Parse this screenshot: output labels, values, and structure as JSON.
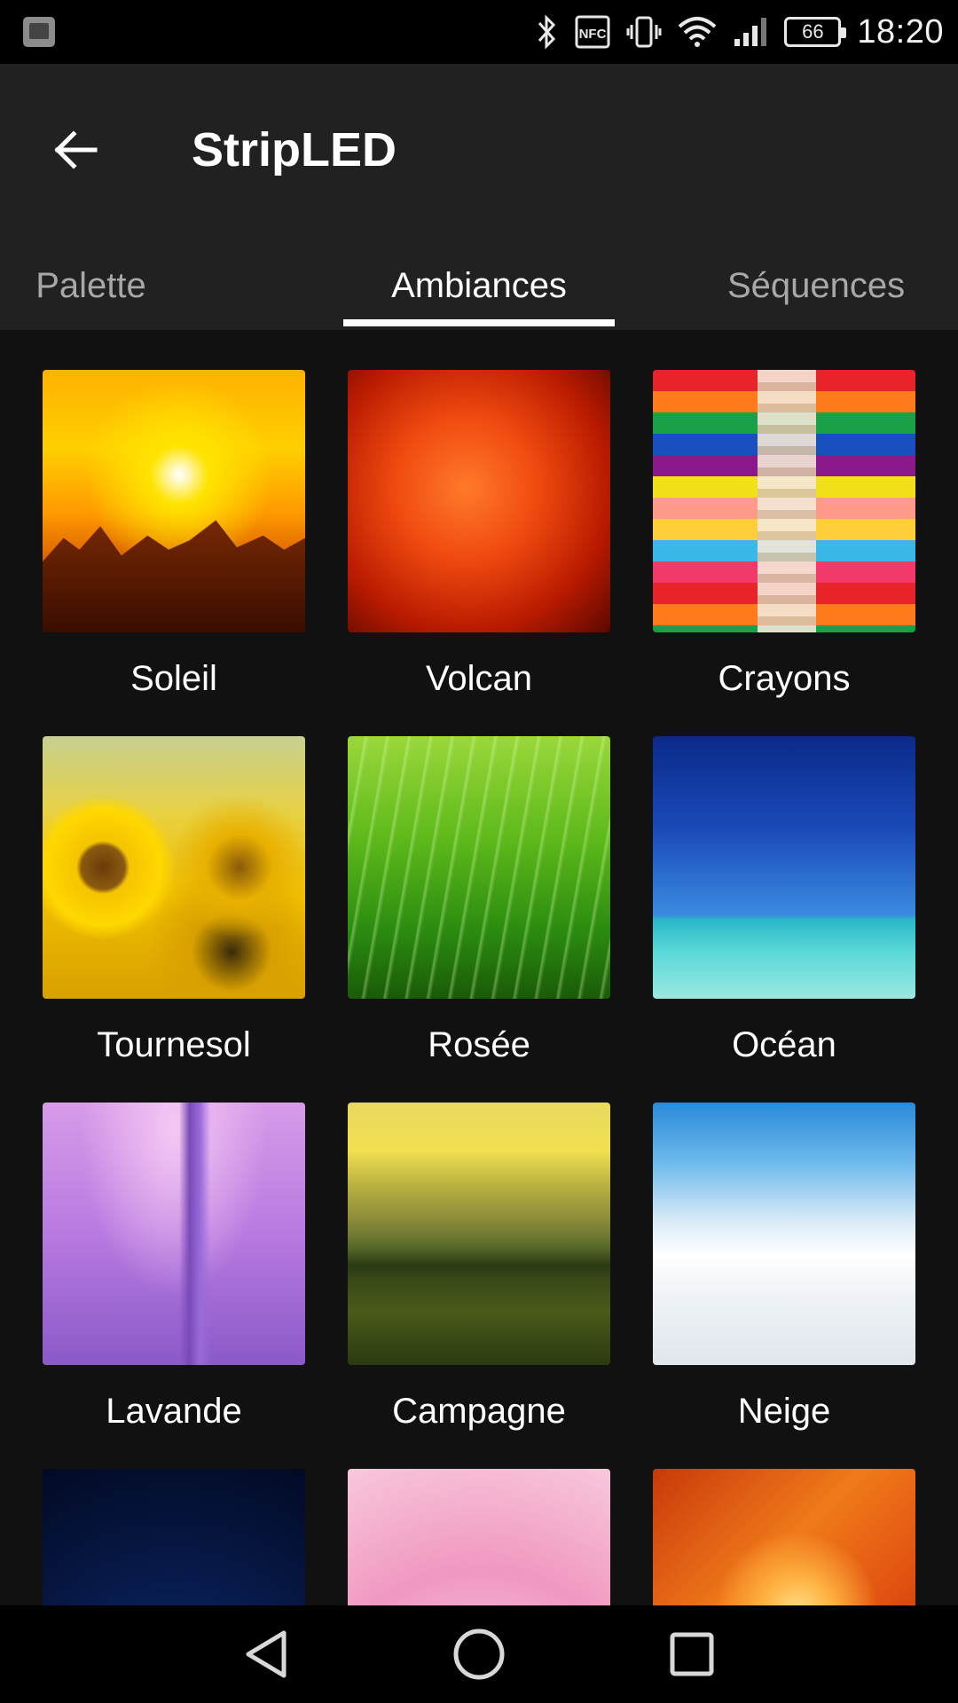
{
  "status_bar": {
    "time": "18:20",
    "battery": "66",
    "icons": [
      "gallery-notification-icon",
      "bluetooth-icon",
      "nfc-icon",
      "vibrate-icon",
      "wifi-icon",
      "signal-icon",
      "battery-icon"
    ],
    "nfc_label": "NFC"
  },
  "app_bar": {
    "title": "StripLED",
    "back_icon": "arrow-left-icon"
  },
  "tabs": [
    {
      "label": "Palette",
      "selected": false
    },
    {
      "label": "Ambiances",
      "selected": true
    },
    {
      "label": "Séquences",
      "selected": false
    }
  ],
  "ambiances": [
    {
      "label": "Soleil",
      "image": "sunset-over-mountains"
    },
    {
      "label": "Volcan",
      "image": "red-lava-rock"
    },
    {
      "label": "Crayons",
      "image": "colored-pencils"
    },
    {
      "label": "Tournesol",
      "image": "sunflowers"
    },
    {
      "label": "Rosée",
      "image": "dewy-green-grass"
    },
    {
      "label": "Océan",
      "image": "blue-sea-horizon"
    },
    {
      "label": "Lavande",
      "image": "lavender-flowers"
    },
    {
      "label": "Campagne",
      "image": "countryside-hills"
    },
    {
      "label": "Neige",
      "image": "snowy-landscape"
    },
    {
      "label": "",
      "image": "moon-night-sky"
    },
    {
      "label": "",
      "image": "pink-flower"
    },
    {
      "label": "",
      "image": "orange-canyon"
    }
  ],
  "nav_bar": {
    "icons": [
      "nav-back-icon",
      "nav-home-icon",
      "nav-recents-icon"
    ]
  },
  "colors": {
    "status_bar_bg": "#000000",
    "app_bar_bg": "#212121",
    "content_bg": "#111111",
    "tab_active": "#ffffff",
    "tab_inactive": "#a8a8a8"
  }
}
